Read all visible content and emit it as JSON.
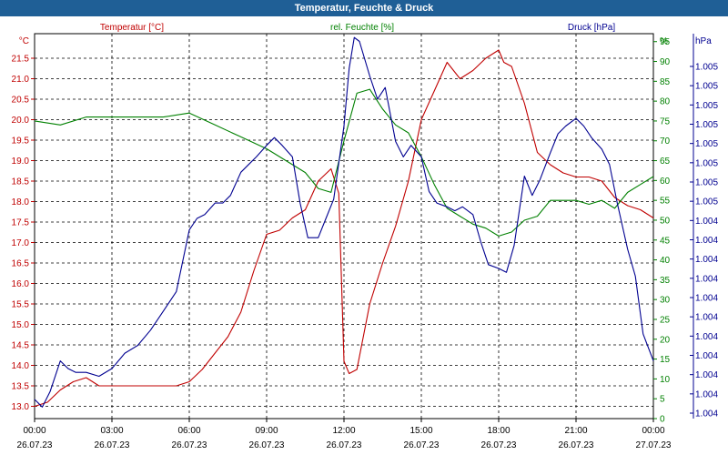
{
  "title": "Temperatur, Feuchte & Druck",
  "colors": {
    "title_bar": "#1f5f96",
    "temperature": "#c00000",
    "humidity": "#008000",
    "pressure": "#000090",
    "grid": "#000000"
  },
  "chart_data": {
    "type": "line",
    "title": "Temperatur, Feuchte & Druck",
    "x_ticks": [
      {
        "time": "00:00",
        "date": "26.07.23"
      },
      {
        "time": "03:00",
        "date": "26.07.23"
      },
      {
        "time": "06:00",
        "date": "26.07.23"
      },
      {
        "time": "09:00",
        "date": "26.07.23"
      },
      {
        "time": "12:00",
        "date": "26.07.23"
      },
      {
        "time": "15:00",
        "date": "26.07.23"
      },
      {
        "time": "18:00",
        "date": "26.07.23"
      },
      {
        "time": "21:00",
        "date": "26.07.23"
      },
      {
        "time": "00:00",
        "date": "27.07.23"
      }
    ],
    "xlim_hours": [
      0,
      24
    ],
    "grid": true,
    "axes": {
      "temperature": {
        "unit": "°C",
        "label": "Temperatur [°C]",
        "ylim": [
          12.7,
          22.1
        ],
        "ticks": [
          "21.5",
          "21.0",
          "20.5",
          "20.0",
          "19.5",
          "19.0",
          "18.5",
          "18.0",
          "17.5",
          "17.0",
          "16.5",
          "16.0",
          "15.5",
          "15.0",
          "14.5",
          "14.0",
          "13.5",
          "13.0"
        ]
      },
      "humidity": {
        "unit": "%",
        "label": "rel. Feuchte [%]",
        "ylim": [
          0,
          97
        ],
        "ticks": [
          "95",
          "90",
          "85",
          "80",
          "75",
          "70",
          "65",
          "60",
          "55",
          "50",
          "45",
          "40",
          "35",
          "30",
          "25",
          "20",
          "15",
          "10",
          "5",
          "0"
        ]
      },
      "pressure": {
        "unit": "hPa",
        "label": "Druck [hPa]",
        "ticks": [
          "1.005",
          "1.005",
          "1.005",
          "1.005",
          "1.005",
          "1.005",
          "1.005",
          "1.005",
          "1.004",
          "1.004",
          "1.004",
          "1.004",
          "1.004",
          "1.004",
          "1.004",
          "1.004",
          "1.004",
          "1.004",
          "1.004"
        ]
      }
    },
    "series": [
      {
        "name": "Temperatur [°C]",
        "axis": "temperature",
        "color": "#c00000",
        "x": [
          0,
          0.5,
          1,
          1.5,
          2,
          2.5,
          3,
          3.5,
          4,
          4.5,
          5,
          5.5,
          6,
          6.5,
          7,
          7.5,
          8,
          8.5,
          9,
          9.5,
          10,
          10.5,
          11,
          11.5,
          11.8,
          12,
          12.2,
          12.5,
          13,
          13.5,
          14,
          14.5,
          15,
          15.5,
          16,
          16.5,
          17,
          17.5,
          18,
          18.2,
          18.5,
          19,
          19.5,
          20,
          20.5,
          21,
          21.5,
          22,
          22.5,
          23,
          23.5,
          24
        ],
        "values": [
          13.0,
          13.1,
          13.4,
          13.6,
          13.7,
          13.5,
          13.5,
          13.5,
          13.5,
          13.5,
          13.5,
          13.5,
          13.6,
          13.9,
          14.3,
          14.7,
          15.3,
          16.3,
          17.2,
          17.3,
          17.6,
          17.8,
          18.5,
          18.8,
          18.2,
          14.1,
          13.8,
          13.9,
          15.5,
          16.5,
          17.4,
          18.5,
          20.0,
          20.7,
          21.4,
          21.0,
          21.2,
          21.5,
          21.7,
          21.4,
          21.3,
          20.4,
          19.2,
          18.9,
          18.7,
          18.6,
          18.6,
          18.5,
          18.1,
          17.9,
          17.8,
          17.6
        ]
      },
      {
        "name": "rel. Feuchte [%]",
        "axis": "humidity",
        "color": "#008000",
        "x": [
          0,
          1,
          2,
          3,
          4,
          5,
          6,
          7,
          8,
          9,
          10,
          10.5,
          11,
          11.5,
          12,
          12.5,
          13,
          13.5,
          14,
          14.5,
          15,
          15.5,
          16,
          16.5,
          17,
          17.5,
          18,
          18.5,
          19,
          19.5,
          20,
          20.5,
          21,
          21.5,
          22,
          22.5,
          23,
          23.5,
          24
        ],
        "values": [
          75,
          74,
          76,
          76,
          76,
          76,
          77,
          74,
          71,
          68,
          64,
          62,
          58,
          57,
          70,
          82,
          83,
          78,
          74,
          72,
          66,
          59,
          53,
          51,
          49,
          48,
          46,
          47,
          50,
          51,
          55,
          55,
          55,
          54,
          55,
          53,
          57,
          59,
          61
        ]
      },
      {
        "name": "Druck [hPa]",
        "axis": "pressure",
        "color": "#000090",
        "x": [
          0,
          0.3,
          0.6,
          1,
          1.3,
          1.6,
          2,
          2.5,
          3,
          3.5,
          4,
          4.5,
          5,
          5.5,
          6,
          6.3,
          6.6,
          7,
          7.3,
          7.6,
          8,
          8.3,
          8.6,
          9,
          9.3,
          9.6,
          10,
          10.3,
          10.6,
          11,
          11.3,
          11.6,
          12,
          12.2,
          12.4,
          12.6,
          13,
          13.3,
          13.6,
          14,
          14.3,
          14.6,
          15,
          15.3,
          15.6,
          16,
          16.3,
          16.6,
          17,
          17.3,
          17.6,
          18,
          18.3,
          18.6,
          19,
          19.3,
          19.6,
          20,
          20.3,
          20.6,
          21,
          21.3,
          21.6,
          22,
          22.3,
          22.6,
          23,
          23.3,
          23.6,
          24
        ],
        "values": [
          0.05,
          0.03,
          0.07,
          0.15,
          0.13,
          0.12,
          0.12,
          0.11,
          0.13,
          0.17,
          0.19,
          0.23,
          0.28,
          0.33,
          0.49,
          0.52,
          0.53,
          0.56,
          0.56,
          0.58,
          0.64,
          0.66,
          0.68,
          0.71,
          0.73,
          0.71,
          0.68,
          0.56,
          0.47,
          0.47,
          0.52,
          0.57,
          0.76,
          0.91,
          0.99,
          0.98,
          0.89,
          0.83,
          0.86,
          0.72,
          0.68,
          0.71,
          0.68,
          0.59,
          0.56,
          0.55,
          0.54,
          0.55,
          0.53,
          0.46,
          0.4,
          0.39,
          0.38,
          0.45,
          0.63,
          0.58,
          0.62,
          0.69,
          0.74,
          0.76,
          0.78,
          0.76,
          0.73,
          0.7,
          0.66,
          0.56,
          0.44,
          0.37,
          0.22,
          0.15
        ]
      }
    ]
  }
}
